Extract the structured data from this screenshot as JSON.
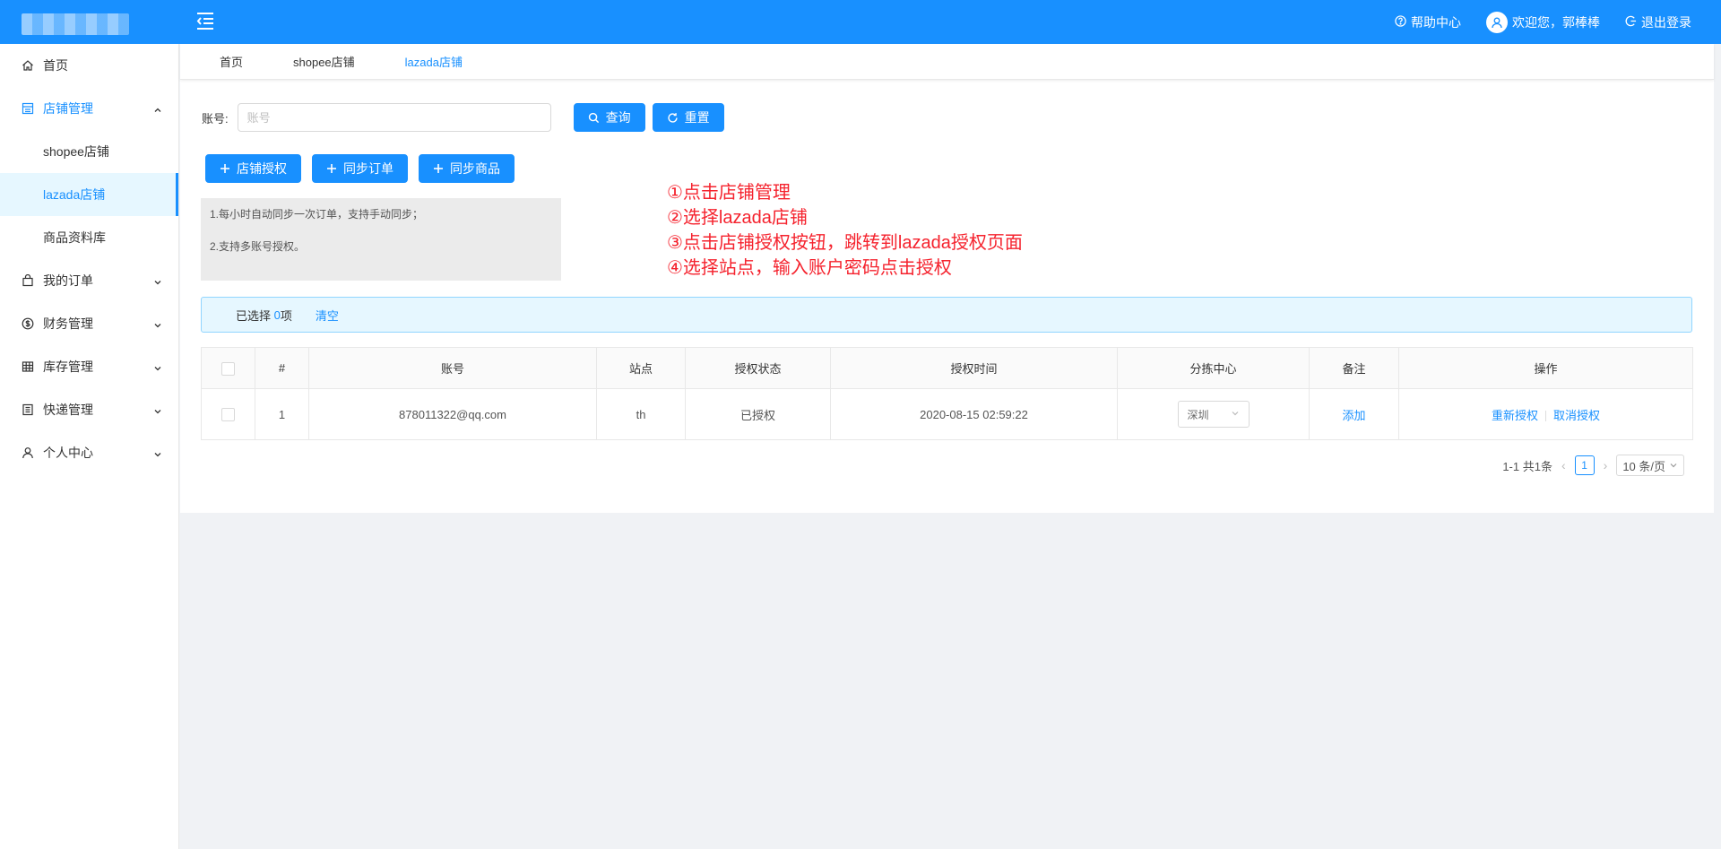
{
  "header": {
    "help_label": "帮助中心",
    "welcome_label": "欢迎您，郭棒棒",
    "logout_label": "退出登录",
    "brand_color": "#1890ff"
  },
  "sidebar": {
    "items": [
      {
        "label": "首页",
        "icon": "home-icon"
      },
      {
        "label": "店铺管理",
        "icon": "shop-icon"
      },
      {
        "label": "shopee店铺"
      },
      {
        "label": "lazada店铺"
      },
      {
        "label": "商品资料库"
      },
      {
        "label": "我的订单",
        "icon": "bag-icon"
      },
      {
        "label": "财务管理",
        "icon": "money-icon"
      },
      {
        "label": "库存管理",
        "icon": "table-icon"
      },
      {
        "label": "快递管理",
        "icon": "list-icon"
      },
      {
        "label": "个人中心",
        "icon": "user-icon"
      }
    ]
  },
  "tabs": [
    {
      "label": "首页"
    },
    {
      "label": "shopee店铺"
    },
    {
      "label": "lazada店铺"
    }
  ],
  "search": {
    "label": "账号:",
    "placeholder": "账号",
    "search_button": "查询",
    "reset_button": "重置"
  },
  "actions": {
    "authorize": "店铺授权",
    "sync_orders": "同步订单",
    "sync_products": "同步商品"
  },
  "info": {
    "line1": "1.每小时自动同步一次订单，支持手动同步；",
    "line2": "2.支持多账号授权。"
  },
  "annotations": {
    "step1": "①点击店铺管理",
    "step2": "②选择lazada店铺",
    "step3": "③点击店铺授权按钮，跳转到lazada授权页面",
    "step4": "④选择站点，输入账户密码点击授权"
  },
  "selection": {
    "prefix": "已选择",
    "count": "0",
    "suffix": "项",
    "clear_label": "清空"
  },
  "table": {
    "headers": {
      "index": "#",
      "account": "账号",
      "site": "站点",
      "status": "授权状态",
      "time": "授权时间",
      "center": "分拣中心",
      "remark": "备注",
      "ops": "操作"
    },
    "rows": [
      {
        "index": "1",
        "account": "878011322@qq.com",
        "site": "th",
        "status": "已授权",
        "time": "2020-08-15 02:59:22",
        "center": "深圳",
        "remark_link": "添加",
        "reauth": "重新授权",
        "cancel": "取消授权"
      }
    ]
  },
  "pagination": {
    "summary": "1-1 共1条",
    "current_page": "1",
    "page_size": "10 条/页"
  }
}
